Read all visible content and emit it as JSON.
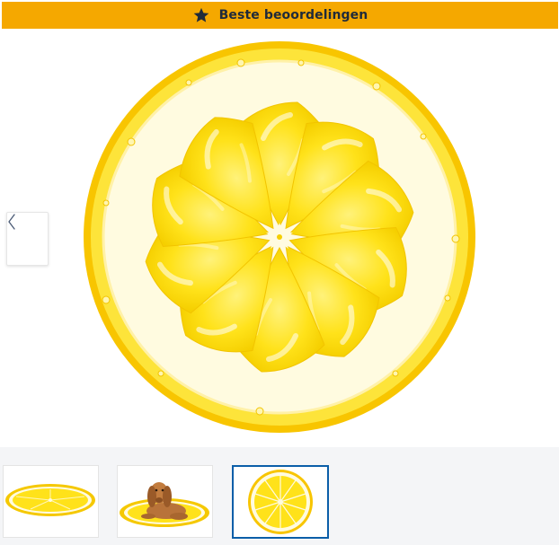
{
  "banner": {
    "icon": "star-icon",
    "label": "Beste beoordelingen",
    "background_color": "#f5a800"
  },
  "gallery": {
    "main_image": "lemon-slice-cooling-mat",
    "prev_button_icon": "chevron-left-icon",
    "thumbnails": [
      {
        "image": "lemon-mat-angled-view",
        "selected": false
      },
      {
        "image": "dog-lying-on-lemon-mat",
        "selected": false
      },
      {
        "image": "lemon-mat-top-view",
        "selected": true
      }
    ],
    "selected_border_color": "#0b5ea8"
  }
}
